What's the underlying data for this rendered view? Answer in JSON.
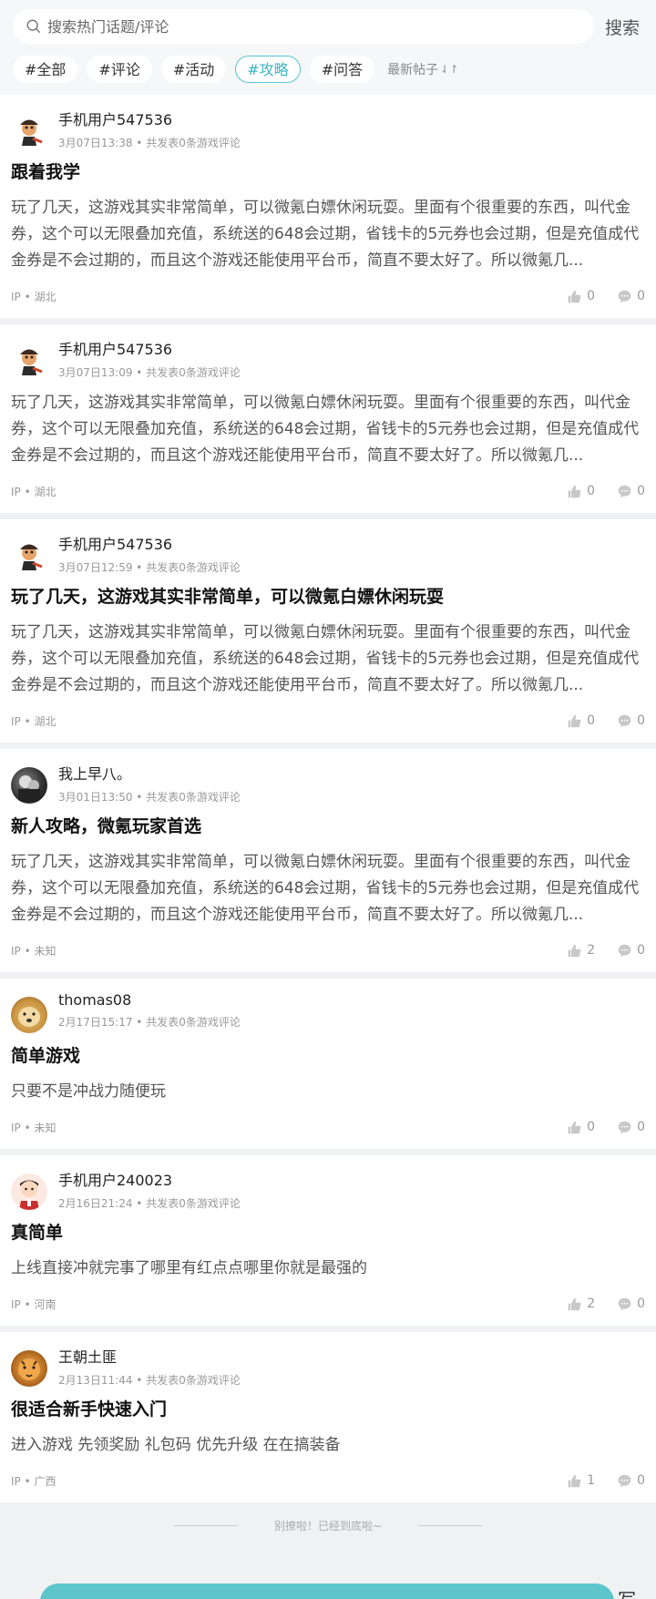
{
  "search": {
    "placeholder": "搜索热门话题/评论",
    "button_label": "搜索"
  },
  "tabs": [
    {
      "label": "#全部",
      "active": false
    },
    {
      "label": "#评论",
      "active": false
    },
    {
      "label": "#活动",
      "active": false
    },
    {
      "label": "#攻略",
      "active": true
    },
    {
      "label": "#问答",
      "active": false
    }
  ],
  "sort": {
    "label": "最新帖子",
    "icon": "sort-arrows-icon"
  },
  "colors": {
    "accent": "#3bb5c5",
    "bottom_bar": "#5cc6cc"
  },
  "posts": [
    {
      "user": "手机用户547536",
      "meta": "3月07日13:38 • 共发表0条游戏评论",
      "avatar": "monkey-avatar",
      "title": "跟着我学",
      "body": "玩了几天，这游戏其实非常简单，可以微氪白嫖休闲玩耍。里面有个很重要的东西，叫代金券，这个可以无限叠加充值，系统送的648会过期，省钱卡的5元券也会过期，但是充值成代金券是不会过期的，而且这个游戏还能使用平台币，简直不要太好了。所以微氪几...",
      "ip": "IP • 湖北",
      "likes": "0",
      "comments": "0"
    },
    {
      "user": "手机用户547536",
      "meta": "3月07日13:09 • 共发表0条游戏评论",
      "avatar": "monkey-avatar",
      "title": "",
      "body": "玩了几天，这游戏其实非常简单，可以微氪白嫖休闲玩耍。里面有个很重要的东西，叫代金券，这个可以无限叠加充值，系统送的648会过期，省钱卡的5元券也会过期，但是充值成代金券是不会过期的，而且这个游戏还能使用平台币，简直不要太好了。所以微氪几...",
      "ip": "IP • 湖北",
      "likes": "0",
      "comments": "0"
    },
    {
      "user": "手机用户547536",
      "meta": "3月07日12:59 • 共发表0条游戏评论",
      "avatar": "monkey-avatar",
      "title": "玩了几天，这游戏其实非常简单，可以微氪白嫖休闲玩耍",
      "body": "玩了几天，这游戏其实非常简单，可以微氪白嫖休闲玩耍。里面有个很重要的东西，叫代金券，这个可以无限叠加充值，系统送的648会过期，省钱卡的5元券也会过期，但是充值成代金券是不会过期的，而且这个游戏还能使用平台币，简直不要太好了。所以微氪几...",
      "ip": "IP • 湖北",
      "likes": "0",
      "comments": "0"
    },
    {
      "user": "我上早八。",
      "meta": "3月01日13:50 • 共发表0条游戏评论",
      "avatar": "photo-avatar",
      "title": "新人攻略，微氪玩家首选",
      "body": "玩了几天，这游戏其实非常简单，可以微氪白嫖休闲玩耍。里面有个很重要的东西，叫代金券，这个可以无限叠加充值，系统送的648会过期，省钱卡的5元券也会过期，但是充值成代金券是不会过期的，而且这个游戏还能使用平台币，简直不要太好了。所以微氪几...",
      "ip": "IP • 未知",
      "likes": "2",
      "comments": "0"
    },
    {
      "user": "thomas08",
      "meta": "2月17日15:17 • 共发表0条游戏评论",
      "avatar": "dog-avatar",
      "title": "简单游戏",
      "body": "只要不是冲战力随便玩",
      "ip": "IP • 未知",
      "likes": "0",
      "comments": "0"
    },
    {
      "user": "手机用户240023",
      "meta": "2月16日21:24 • 共发表0条游戏评论",
      "avatar": "cartoon-boy-avatar",
      "title": "真简单",
      "body": "上线直接冲就完事了哪里有红点点哪里你就是最强的",
      "ip": "IP • 河南",
      "likes": "2",
      "comments": "0"
    },
    {
      "user": "王朝土匪",
      "meta": "2月13日11:44 • 共发表0条游戏评论",
      "avatar": "tiger-avatar",
      "title": "很适合新手快速入门",
      "body": "进入游戏 先领奖励 礼包码 优先升级 在在搞装备",
      "ip": "IP • 广西",
      "likes": "1",
      "comments": "0"
    }
  ],
  "end_text": "别撩啦！已经到底啦~",
  "bottom_text": "写"
}
